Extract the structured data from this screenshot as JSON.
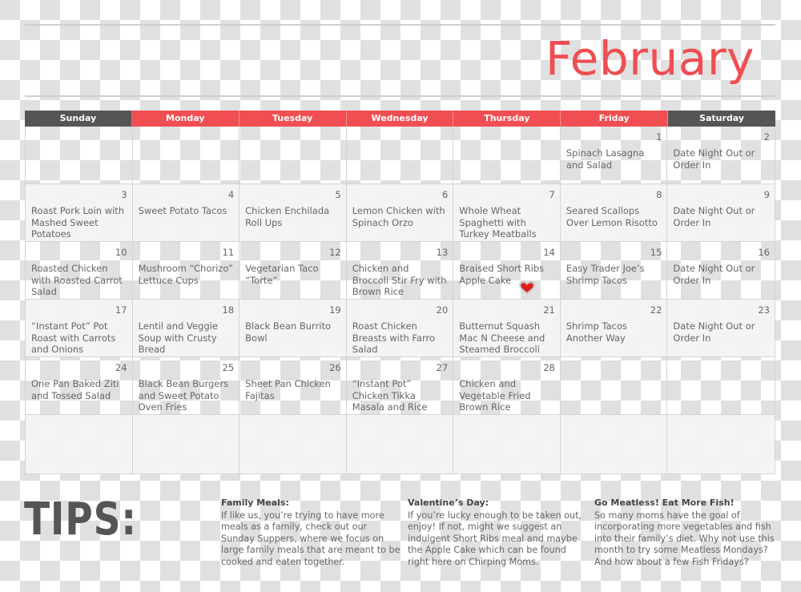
{
  "header": {
    "month": "February",
    "month_color": "#f04e52"
  },
  "colors": {
    "weekend_header": "#555555",
    "weekday_header": "#f04e52",
    "heart": "#dd1c1c"
  },
  "calendar": {
    "weekdays": [
      {
        "label": "Sunday",
        "weekend": true
      },
      {
        "label": "Monday",
        "weekend": false
      },
      {
        "label": "Tuesday",
        "weekend": false
      },
      {
        "label": "Wednesday",
        "weekend": false
      },
      {
        "label": "Thursday",
        "weekend": false
      },
      {
        "label": "Friday",
        "weekend": false
      },
      {
        "label": "Saturday",
        "weekend": true
      }
    ],
    "weeks": [
      [
        {
          "day": "",
          "meal": ""
        },
        {
          "day": "",
          "meal": ""
        },
        {
          "day": "",
          "meal": ""
        },
        {
          "day": "",
          "meal": ""
        },
        {
          "day": "",
          "meal": ""
        },
        {
          "day": "1",
          "meal": "Spinach Lasagna and Salad"
        },
        {
          "day": "2",
          "meal": "Date Night Out or Order In"
        }
      ],
      [
        {
          "day": "3",
          "meal": "Roast Pork Loin with Mashed Sweet Potatoes"
        },
        {
          "day": "4",
          "meal": "Sweet Potato Tacos"
        },
        {
          "day": "5",
          "meal": "Chicken Enchilada Roll Ups"
        },
        {
          "day": "6",
          "meal": "Lemon Chicken with Spinach Orzo"
        },
        {
          "day": "7",
          "meal": "Whole Wheat Spaghetti with Turkey Meatballs"
        },
        {
          "day": "8",
          "meal": "Seared Scallops Over Lemon Risotto"
        },
        {
          "day": "9",
          "meal": "Date Night Out or Order In"
        }
      ],
      [
        {
          "day": "10",
          "meal": "Roasted Chicken with Roasted Carrot Salad"
        },
        {
          "day": "11",
          "meal": "Mushroom “Chorizo” Lettuce Cups"
        },
        {
          "day": "12",
          "meal": "Vegetarian Taco “Torte”"
        },
        {
          "day": "13",
          "meal": "Chicken and Broccoli Stir Fry with Brown Rice"
        },
        {
          "day": "14",
          "meal": "Braised Short Ribs Apple Cake",
          "icon": "heart-icon"
        },
        {
          "day": "15",
          "meal": "Easy Trader Joe’s Shrimp Tacos"
        },
        {
          "day": "16",
          "meal": "Date Night Out or Order In"
        }
      ],
      [
        {
          "day": "17",
          "meal": "“Instant Pot” Pot Roast with Carrots and Onions"
        },
        {
          "day": "18",
          "meal": "Lentil and Veggie Soup with Crusty Bread"
        },
        {
          "day": "19",
          "meal": "Black Bean Burrito Bowl"
        },
        {
          "day": "20",
          "meal": "Roast Chicken Breasts with Farro Salad"
        },
        {
          "day": "21",
          "meal": "Butternut Squash Mac N Cheese and Steamed Broccoli"
        },
        {
          "day": "22",
          "meal": "Shrimp Tacos Another Way"
        },
        {
          "day": "23",
          "meal": "Date Night Out or Order In"
        }
      ],
      [
        {
          "day": "24",
          "meal": "One Pan Baked Ziti and Tossed Salad"
        },
        {
          "day": "25",
          "meal": "Black Bean Burgers and Sweet Potato Oven Fries"
        },
        {
          "day": "26",
          "meal": "Sheet Pan Chicken Fajitas"
        },
        {
          "day": "27",
          "meal": "“Instant Pot” Chicken Tikka Masala and Rice"
        },
        {
          "day": "28",
          "meal": "Chicken and Vegetable Fried Brown Rice"
        },
        {
          "day": "",
          "meal": ""
        },
        {
          "day": "",
          "meal": ""
        }
      ],
      [
        {
          "day": "",
          "meal": ""
        },
        {
          "day": "",
          "meal": ""
        },
        {
          "day": "",
          "meal": ""
        },
        {
          "day": "",
          "meal": ""
        },
        {
          "day": "",
          "meal": ""
        },
        {
          "day": "",
          "meal": ""
        },
        {
          "day": "",
          "meal": ""
        }
      ]
    ]
  },
  "tips": {
    "heading": "TIPS:",
    "items": [
      {
        "title": "Family Meals:",
        "body": "If like us, you’re trying to have more meals as a family, check out our Sunday Suppers, where we focus on large family meals that are meant to be cooked and eaten together."
      },
      {
        "title": "Valentine’s Day:",
        "body": "If you’re lucky enough to be taken out, enjoy!  If not, might we suggest an indulgent Short Ribs meal and maybe the Apple Cake which can be found right here on Chirping Moms."
      },
      {
        "title": "Go Meatless! Eat More Fish!",
        "body": "So many moms have the goal of incorporating more vegetables and fish into their family’s diet. Why not use this month to try some Meatless Mondays? And how about a few Fish Fridays?"
      }
    ]
  }
}
